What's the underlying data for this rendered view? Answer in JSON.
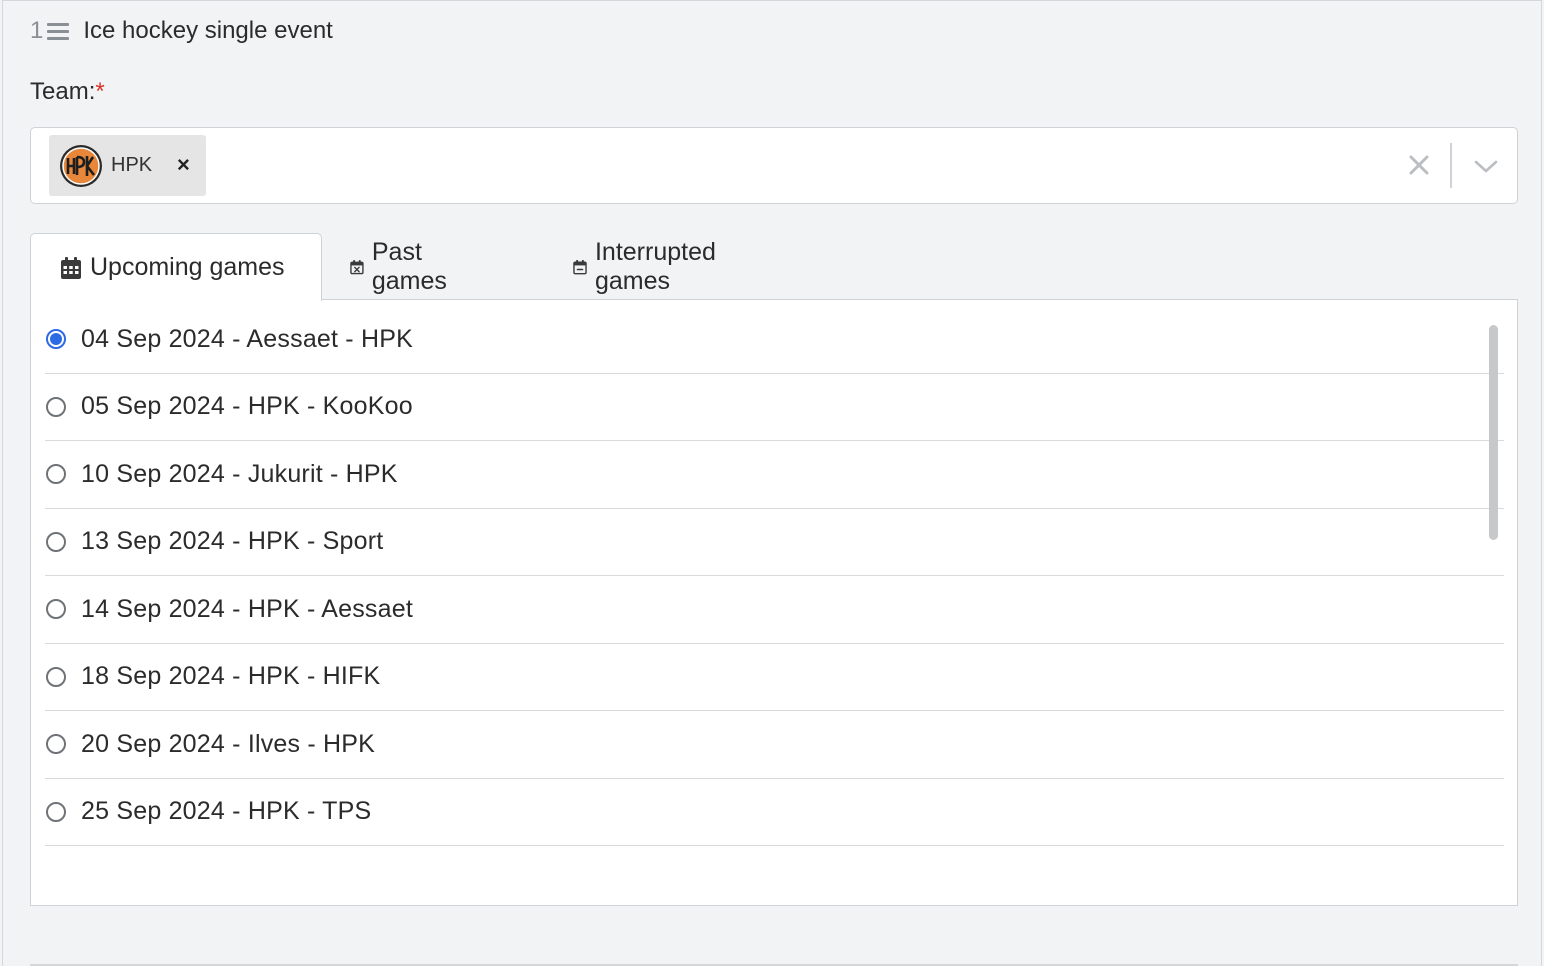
{
  "section": {
    "step_number": "1",
    "title": "Ice hockey single event"
  },
  "team_field": {
    "label": "Team:",
    "required_marker": "*",
    "selected": [
      {
        "label": "HPK",
        "logo": "hpk-logo"
      }
    ],
    "remove_chip_symbol": "×"
  },
  "tabs": [
    {
      "label": "Upcoming games",
      "icon": "calendar-icon",
      "active": true
    },
    {
      "label": "Past games",
      "icon": "calendar-x-icon",
      "active": false
    },
    {
      "label": "Interrupted games",
      "icon": "calendar-minus-icon",
      "active": false
    }
  ],
  "games": [
    {
      "label": "04 Sep 2024 - Aessaet - HPK",
      "selected": true
    },
    {
      "label": "05 Sep 2024 - HPK - KooKoo",
      "selected": false
    },
    {
      "label": "10 Sep 2024 - Jukurit - HPK",
      "selected": false
    },
    {
      "label": "13 Sep 2024 - HPK - Sport",
      "selected": false
    },
    {
      "label": "14 Sep 2024 - HPK - Aessaet",
      "selected": false
    },
    {
      "label": "18 Sep 2024 - HPK - HIFK",
      "selected": false
    },
    {
      "label": "20 Sep 2024 - Ilves - HPK",
      "selected": false
    },
    {
      "label": "25 Sep 2024 - HPK - TPS",
      "selected": false
    }
  ],
  "colors": {
    "accent": "#2d6be4",
    "required": "#d9342b",
    "logo_orange": "#e8873a"
  }
}
